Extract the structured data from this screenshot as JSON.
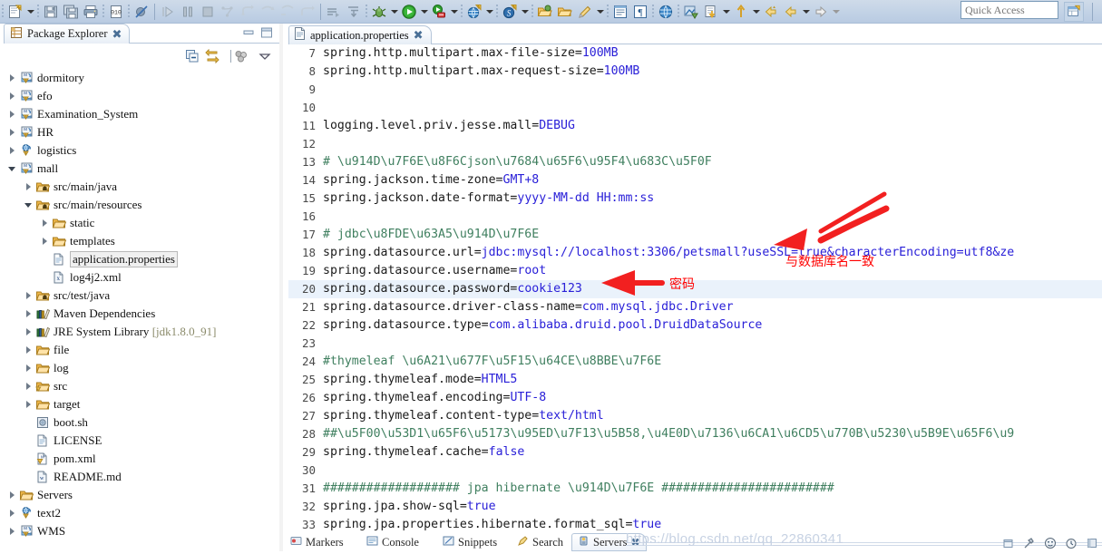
{
  "toolbar": {
    "quick_access": "Quick Access",
    "items": [
      {
        "name": "new-wizard-icon",
        "glyph": "new"
      },
      {
        "name": "new-dropdown-arrow",
        "glyph": "arrow"
      },
      {
        "name": "save-icon",
        "glyph": "save"
      },
      {
        "name": "save-all-icon",
        "glyph": "saveall"
      },
      {
        "name": "print-icon",
        "glyph": "print"
      },
      {
        "name": "toggle-breakpoint-icon",
        "glyph": "010"
      },
      {
        "name": "skip-breakpoints-icon",
        "glyph": "skipbp"
      },
      {
        "name": "resume-icon",
        "glyph": "resume"
      },
      {
        "name": "suspend-icon",
        "glyph": "suspend"
      },
      {
        "name": "terminate-icon",
        "glyph": "terminate"
      },
      {
        "name": "step-into-icon",
        "glyph": "stepinto"
      },
      {
        "name": "step-over-icon",
        "glyph": "stepover"
      },
      {
        "name": "step-return-icon",
        "glyph": "stepreturn"
      },
      {
        "name": "next-annotation-icon",
        "glyph": "nextann"
      },
      {
        "name": "previous-annotation-icon",
        "glyph": "prevann"
      },
      {
        "name": "debug-icon",
        "glyph": "debug"
      },
      {
        "name": "debug-dropdown-arrow",
        "glyph": "arrow"
      },
      {
        "name": "run-icon",
        "glyph": "run"
      },
      {
        "name": "run-dropdown-arrow",
        "glyph": "arrow"
      },
      {
        "name": "run-external-tools-icon",
        "glyph": "exttools"
      },
      {
        "name": "external-tools-dropdown-arrow",
        "glyph": "arrow"
      },
      {
        "name": "new-dynamic-web-project-icon",
        "glyph": "webproj"
      },
      {
        "name": "web-dropdown-arrow",
        "glyph": "arrow"
      },
      {
        "name": "search-icon",
        "glyph": "search"
      },
      {
        "name": "search-dropdown-arrow",
        "glyph": "arrow"
      },
      {
        "name": "open-type-icon",
        "glyph": "opentype"
      },
      {
        "name": "open-resource-icon",
        "glyph": "openres"
      },
      {
        "name": "pencil-icon",
        "glyph": "pencil"
      },
      {
        "name": "pencil-dropdown-arrow",
        "glyph": "arrow"
      },
      {
        "name": "show-whitespace-icon",
        "glyph": "whitespace"
      },
      {
        "name": "pilcrow-icon",
        "glyph": "pilcrow"
      },
      {
        "name": "open-web-browser-icon",
        "glyph": "browser"
      },
      {
        "name": "open-task-icon",
        "glyph": "task"
      },
      {
        "name": "previous-edit-icon",
        "glyph": "prevedit"
      },
      {
        "name": "prevedit-dropdown-arrow",
        "glyph": "arrow"
      },
      {
        "name": "next-edit-icon",
        "glyph": "nextedit"
      },
      {
        "name": "nextedit-dropdown-arrow",
        "glyph": "arrow"
      },
      {
        "name": "back-icon",
        "glyph": "back"
      },
      {
        "name": "forward-icon",
        "glyph": "forward"
      },
      {
        "name": "forward-dropdown-arrow",
        "glyph": "arrow"
      },
      {
        "name": "forward2-icon",
        "glyph": "fwd2"
      },
      {
        "name": "fwd2-dropdown-arrow",
        "glyph": "arrowgrey"
      }
    ]
  },
  "package_explorer": {
    "title": "Package Explorer",
    "tab_close": "close-icon",
    "tools": [
      {
        "name": "collapse-all-icon"
      },
      {
        "name": "link-with-editor-icon"
      },
      {
        "name": "view-menu-filters-icon"
      },
      {
        "name": "view-menu-icon"
      }
    ],
    "tree": [
      {
        "label": "dormitory",
        "indent": 0,
        "twisty": "closed",
        "icon": "maven-project"
      },
      {
        "label": "efo",
        "indent": 0,
        "twisty": "closed",
        "icon": "maven-project"
      },
      {
        "label": "Examination_System",
        "indent": 0,
        "twisty": "closed",
        "icon": "maven-project"
      },
      {
        "label": "HR",
        "indent": 0,
        "twisty": "closed",
        "icon": "maven-project"
      },
      {
        "label": "logistics",
        "indent": 0,
        "twisty": "closed",
        "icon": "web-project"
      },
      {
        "label": "mall",
        "indent": 0,
        "twisty": "open",
        "icon": "maven-project"
      },
      {
        "label": "src/main/java",
        "indent": 1,
        "twisty": "closed",
        "icon": "source-folder"
      },
      {
        "label": "src/main/resources",
        "indent": 1,
        "twisty": "open",
        "icon": "source-folder"
      },
      {
        "label": "static",
        "indent": 2,
        "twisty": "closed",
        "icon": "folder"
      },
      {
        "label": "templates",
        "indent": 2,
        "twisty": "closed",
        "icon": "folder"
      },
      {
        "label": "application.properties",
        "indent": 2,
        "twisty": "none",
        "icon": "file",
        "selected": true
      },
      {
        "label": "log4j2.xml",
        "indent": 2,
        "twisty": "none",
        "icon": "xml-file"
      },
      {
        "label": "src/test/java",
        "indent": 1,
        "twisty": "closed",
        "icon": "source-folder"
      },
      {
        "label": "Maven Dependencies",
        "indent": 1,
        "twisty": "closed",
        "icon": "library"
      },
      {
        "label": "JRE System Library",
        "suffix": " [jdk1.8.0_91]",
        "indent": 1,
        "twisty": "closed",
        "icon": "library"
      },
      {
        "label": "file",
        "indent": 1,
        "twisty": "closed",
        "icon": "folder"
      },
      {
        "label": "log",
        "indent": 1,
        "twisty": "closed",
        "icon": "folder"
      },
      {
        "label": "src",
        "indent": 1,
        "twisty": "closed",
        "icon": "folder-warn"
      },
      {
        "label": "target",
        "indent": 1,
        "twisty": "closed",
        "icon": "folder"
      },
      {
        "label": "boot.sh",
        "indent": 1,
        "twisty": "none",
        "icon": "sh-file"
      },
      {
        "label": "LICENSE",
        "indent": 1,
        "twisty": "none",
        "icon": "file"
      },
      {
        "label": "pom.xml",
        "indent": 1,
        "twisty": "none",
        "icon": "pom-file"
      },
      {
        "label": "README.md",
        "indent": 1,
        "twisty": "none",
        "icon": "md-file"
      },
      {
        "label": "Servers",
        "indent": 0,
        "twisty": "closed",
        "icon": "folder"
      },
      {
        "label": "text2",
        "indent": 0,
        "twisty": "closed",
        "icon": "web-project"
      },
      {
        "label": "WMS",
        "indent": 0,
        "twisty": "closed",
        "icon": "maven-project"
      }
    ]
  },
  "editor": {
    "tab_title": "application.properties",
    "tab_icon": "properties-file-icon",
    "tab_close": "close-icon",
    "current_line": 20,
    "lines": [
      {
        "n": 7,
        "tokens": [
          {
            "t": "spring.http.multipart.max-file-size=",
            "c": "k"
          },
          {
            "t": "100MB",
            "c": "v"
          }
        ]
      },
      {
        "n": 8,
        "tokens": [
          {
            "t": "spring.http.multipart.max-request-size=",
            "c": "k"
          },
          {
            "t": "100MB",
            "c": "v"
          }
        ]
      },
      {
        "n": 9,
        "tokens": []
      },
      {
        "n": 10,
        "tokens": []
      },
      {
        "n": 11,
        "tokens": [
          {
            "t": "logging.level.priv.jesse.mall=",
            "c": "k"
          },
          {
            "t": "DEBUG",
            "c": "v"
          }
        ]
      },
      {
        "n": 12,
        "tokens": []
      },
      {
        "n": 13,
        "tokens": [
          {
            "t": "# \\u914D\\u7F6E\\u8F6Cjson\\u7684\\u65F6\\u95F4\\u683C\\u5F0F",
            "c": "c"
          }
        ]
      },
      {
        "n": 14,
        "tokens": [
          {
            "t": "spring.jackson.time-zone=",
            "c": "k"
          },
          {
            "t": "GMT+8",
            "c": "v"
          }
        ]
      },
      {
        "n": 15,
        "tokens": [
          {
            "t": "spring.jackson.date-format=",
            "c": "k"
          },
          {
            "t": "yyyy-MM-dd HH:mm:ss",
            "c": "v"
          }
        ]
      },
      {
        "n": 16,
        "tokens": []
      },
      {
        "n": 17,
        "tokens": [
          {
            "t": "# jdbc\\u8FDE\\u63A5\\u914D\\u7F6E",
            "c": "c"
          }
        ]
      },
      {
        "n": 18,
        "tokens": [
          {
            "t": "spring.datasource.url=",
            "c": "k"
          },
          {
            "t": "jdbc:mysql://localhost:3306/petsmall?useSSL=true&characterEncoding=utf8&ze",
            "c": "v"
          }
        ]
      },
      {
        "n": 19,
        "tokens": [
          {
            "t": "spring.datasource.username=",
            "c": "k"
          },
          {
            "t": "root",
            "c": "v"
          }
        ]
      },
      {
        "n": 20,
        "tokens": [
          {
            "t": "spring.datasource.password=",
            "c": "k"
          },
          {
            "t": "cookie123",
            "c": "v"
          }
        ]
      },
      {
        "n": 21,
        "tokens": [
          {
            "t": "spring.datasource.driver-class-name=",
            "c": "k"
          },
          {
            "t": "com.mysql.jdbc.Driver",
            "c": "v"
          }
        ]
      },
      {
        "n": 22,
        "tokens": [
          {
            "t": "spring.datasource.type=",
            "c": "k"
          },
          {
            "t": "com.alibaba.druid.pool.DruidDataSource",
            "c": "v"
          }
        ]
      },
      {
        "n": 23,
        "tokens": []
      },
      {
        "n": 24,
        "tokens": [
          {
            "t": "#thymeleaf \\u6A21\\u677F\\u5F15\\u64CE\\u8BBE\\u7F6E",
            "c": "c"
          }
        ]
      },
      {
        "n": 25,
        "tokens": [
          {
            "t": "spring.thymeleaf.mode=",
            "c": "k"
          },
          {
            "t": "HTML5",
            "c": "v"
          }
        ]
      },
      {
        "n": 26,
        "tokens": [
          {
            "t": "spring.thymeleaf.encoding=",
            "c": "k"
          },
          {
            "t": "UTF-8",
            "c": "v"
          }
        ]
      },
      {
        "n": 27,
        "tokens": [
          {
            "t": "spring.thymeleaf.content-type=",
            "c": "k"
          },
          {
            "t": "text/html",
            "c": "v"
          }
        ]
      },
      {
        "n": 28,
        "tokens": [
          {
            "t": "##\\u5F00\\u53D1\\u65F6\\u5173\\u95ED\\u7F13\\u5B58,\\u4E0D\\u7136\\u6CA1\\u6CD5\\u770B\\u5230\\u5B9E\\u65F6\\u9",
            "c": "c"
          }
        ]
      },
      {
        "n": 29,
        "tokens": [
          {
            "t": "spring.thymeleaf.cache=",
            "c": "k"
          },
          {
            "t": "false",
            "c": "v"
          }
        ]
      },
      {
        "n": 30,
        "tokens": []
      },
      {
        "n": 31,
        "tokens": [
          {
            "t": "################### jpa hibernate \\u914D\\u7F6E ########################",
            "c": "c"
          }
        ]
      },
      {
        "n": 32,
        "tokens": [
          {
            "t": "spring.jpa.show-sql=",
            "c": "k"
          },
          {
            "t": "true",
            "c": "v"
          }
        ]
      },
      {
        "n": 33,
        "tokens": [
          {
            "t": "spring.jpa.properties.hibernate.format_sql=",
            "c": "k"
          },
          {
            "t": "true",
            "c": "v"
          }
        ]
      }
    ],
    "hscroll_grip": "|||"
  },
  "annotations": {
    "color": "#ff0000",
    "db_name_note": "与数据库名一致",
    "password_note": "密码"
  },
  "bottom_tabs": [
    {
      "label": "Markers",
      "icon": "markers-icon",
      "active": false
    },
    {
      "label": "Console",
      "icon": "console-icon",
      "active": false
    },
    {
      "label": "Snippets",
      "icon": "snippets-icon",
      "active": false
    },
    {
      "label": "Search",
      "icon": "search-icon",
      "active": false
    },
    {
      "label": "Servers",
      "icon": "servers-icon",
      "active": true
    }
  ],
  "watermark": "https://blog.csdn.net/qq_22860341"
}
